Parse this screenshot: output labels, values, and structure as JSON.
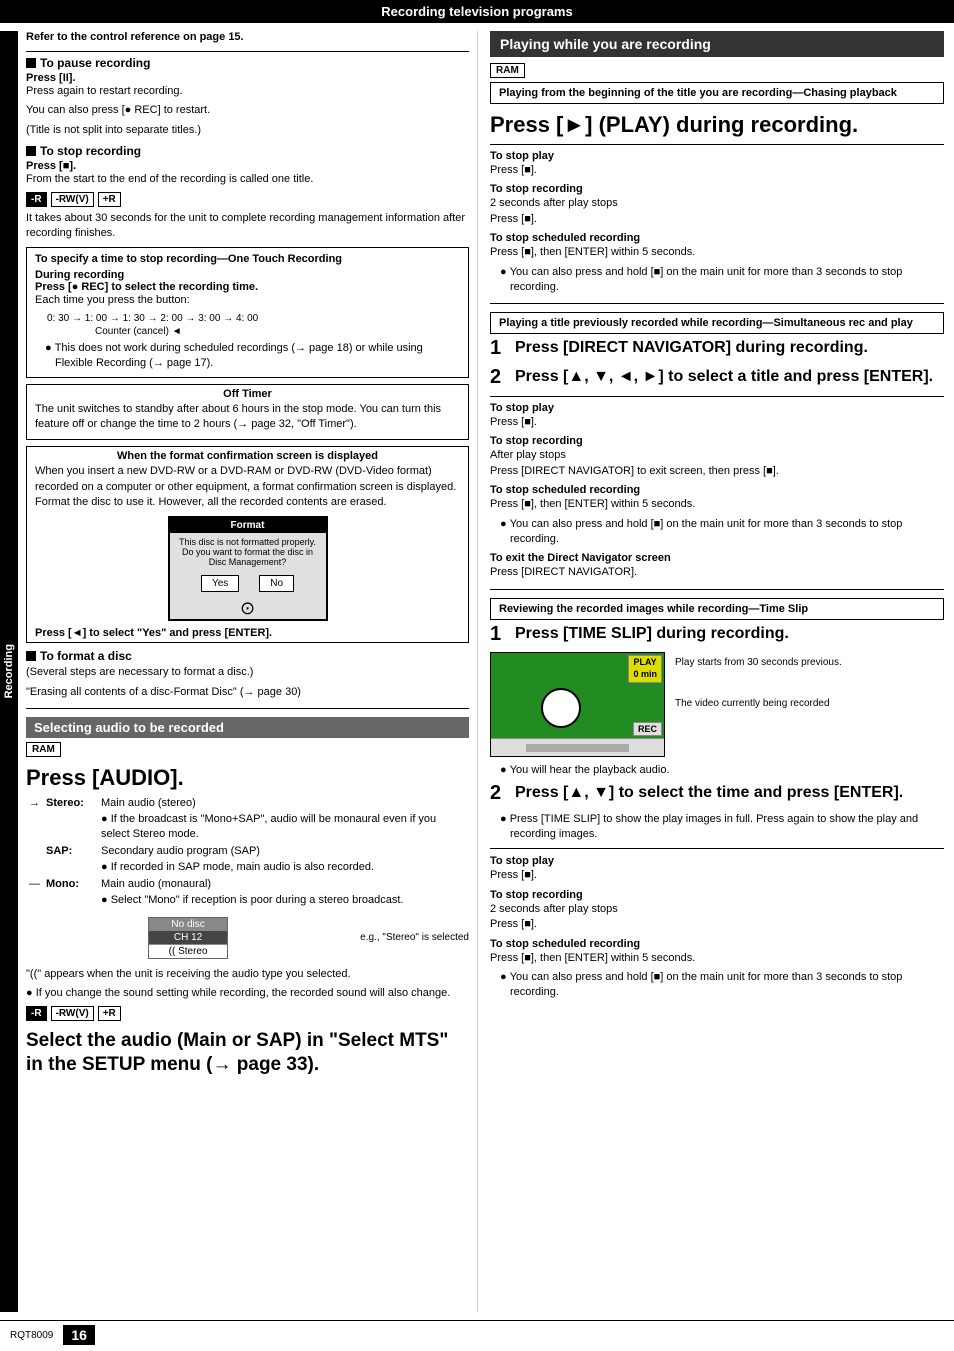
{
  "header": {
    "title": "Recording television programs"
  },
  "footer": {
    "rqt": "RQT8009",
    "page": "16"
  },
  "left": {
    "refer": "Refer to the control reference on page 15.",
    "pause_title": "To pause recording",
    "pause_press": "Press [II].",
    "pause_body1": "Press again to restart recording.",
    "pause_body2": "You can also press [● REC] to restart.",
    "pause_body3": "(Title is not split into separate titles.)",
    "stop_title": "To stop recording",
    "stop_press": "Press [■].",
    "stop_body": "From the start to the end of the recording is called one title.",
    "stop_badge1": "-R",
    "stop_badge2": "-RW(V)",
    "stop_badge3": "+R",
    "stop_info": "It takes about 30 seconds for the unit to complete recording management information after recording finishes.",
    "one_touch_box_title": "To specify a time to stop recording—One Touch Recording",
    "during_rec": "During recording",
    "press_rec_bold": "Press [● REC] to select the recording time.",
    "each_time": "Each time you press the button:",
    "counter_row": "0: 30  →  1: 00  →  1: 30  →  2: 00  →  3: 00  →  4: 00",
    "counter_label": "Counter (cancel) ◄",
    "bullet_one_touch": "This does not work during scheduled recordings (→ page 18) or while using Flexible Recording (→ page 17).",
    "off_timer_title": "Off Timer",
    "off_timer_body": "The unit switches to standby after about 6 hours in the stop mode. You can turn this feature off or change the time to 2 hours (→ page 32, \"Off Timer\").",
    "format_confirm_title": "When the format confirmation screen is displayed",
    "format_confirm_body": "When you insert a new DVD-RW or a DVD-RAM or DVD-RW (DVD-Video format) recorded on a computer or other equipment, a format confirmation screen is displayed. Format the disc to use it. However, all the recorded contents are erased.",
    "format_dialog_title": "Format",
    "format_dialog_body": "This disc is not formatted properly.\nDo you want to format the\ndisc in Disc Management?",
    "format_yes": "Yes",
    "format_no": "No",
    "press_select_yes": "Press [◄] to select \"Yes\" and press [ENTER].",
    "format_disc_title": "To format a disc",
    "format_disc_body1": "(Several steps are necessary to format a disc.)",
    "format_disc_body2": "\"Erasing all contents of a disc-Format Disc\" (→ page 30)",
    "select_audio_header": "Selecting audio to be recorded",
    "ram_badge": "RAM",
    "press_audio": "Press [AUDIO].",
    "stereo_label": "Stereo:",
    "stereo_body1": "Main audio (stereo)",
    "stereo_bullet": "If the broadcast is \"Mono+SAP\", audio will be monaural even if you select Stereo mode.",
    "sap_label": "SAP:",
    "sap_body": "Secondary audio program (SAP)",
    "sap_bullet": "If recorded in SAP mode, main audio is also recorded.",
    "mono_label": "Mono:",
    "mono_body": "Main audio (monaural)",
    "mono_bullet": "Select \"Mono\" if reception is poor during a stereo broadcast.",
    "no_disc": "No disc",
    "ch12": "CH 12",
    "stereo_sel": "(( Stereo",
    "eg_stereo": "e.g., \"Stereo\" is selected",
    "double_paren": "\"((\" appears when the unit is receiving the audio type you selected.",
    "sound_change": "If you change the sound setting while recording, the recorded sound will also change.",
    "badges2_1": "-R",
    "badges2_2": "-RW(V)",
    "badges2_3": "+R",
    "select_mts": "Select the audio (Main or SAP) in \"Select MTS\" in the SETUP menu (→ page 33)."
  },
  "right": {
    "play_while_recording_header": "Playing while you are recording",
    "ram_badge": "RAM",
    "chasing_box": "Playing from the beginning of the title you are recording—Chasing playback",
    "press_play_big": "Press [►] (PLAY) during recording.",
    "stop_play_label": "To stop play",
    "stop_play_press": "Press [■].",
    "stop_rec_label": "To stop recording",
    "stop_rec_body": "2 seconds after play stops\nPress [■].",
    "stop_sched_label": "To stop scheduled recording",
    "stop_sched_body1": "Press [■], then [ENTER] within 5 seconds.",
    "stop_sched_bullet": "You can also press and hold [■] on the main unit for more than 3 seconds to stop recording.",
    "simultaneous_box": "Playing a title previously recorded while recording—Simultaneous rec and play",
    "step1_num": "1",
    "step1_text": "Press [DIRECT NAVIGATOR] during recording.",
    "step2_num": "2",
    "step2_text": "Press [▲, ▼, ◄, ►] to select a title and press [ENTER].",
    "stop_play2_label": "To stop play",
    "stop_play2_press": "Press [■].",
    "stop_rec2_label": "To stop recording",
    "stop_rec2_body": "After play stops\nPress [DIRECT NAVIGATOR] to exit screen, then press [■].",
    "stop_sched2_label": "To stop scheduled recording",
    "stop_sched2_body": "Press [■], then [ENTER] within 5 seconds.",
    "stop_sched2_bullet": "You can also press and hold [■] on the main unit for more than 3 seconds to stop recording.",
    "exit_nav_label": "To exit the Direct Navigator screen",
    "exit_nav_body": "Press [DIRECT NAVIGATOR].",
    "time_slip_box": "Reviewing the recorded images while recording—Time Slip",
    "step3_num": "1",
    "step3_text": "Press [TIME SLIP] during recording.",
    "play_caption": "Play starts from 30 seconds previous.",
    "rec_caption": "The video currently being recorded",
    "play_label_img": "PLAY\n0 min",
    "rec_label_img": "REC",
    "you_will_hear": "You will hear the playback audio.",
    "step4_num": "2",
    "step4_text": "Press [▲, ▼] to select the time and press [ENTER].",
    "step4_bullet": "Press [TIME SLIP] to show the play images in full. Press again to show the play and recording images.",
    "stop_play3_label": "To stop play",
    "stop_play3_press": "Press [■].",
    "stop_rec3_label": "To stop recording",
    "stop_rec3_body": "2 seconds after play stops\nPress [■].",
    "stop_sched3_label": "To stop scheduled recording",
    "stop_sched3_body": "Press [■], then [ENTER] within 5 seconds.",
    "stop_sched3_bullet": "You can also press and hold [■] on the main unit for more than 3 seconds to stop recording."
  }
}
